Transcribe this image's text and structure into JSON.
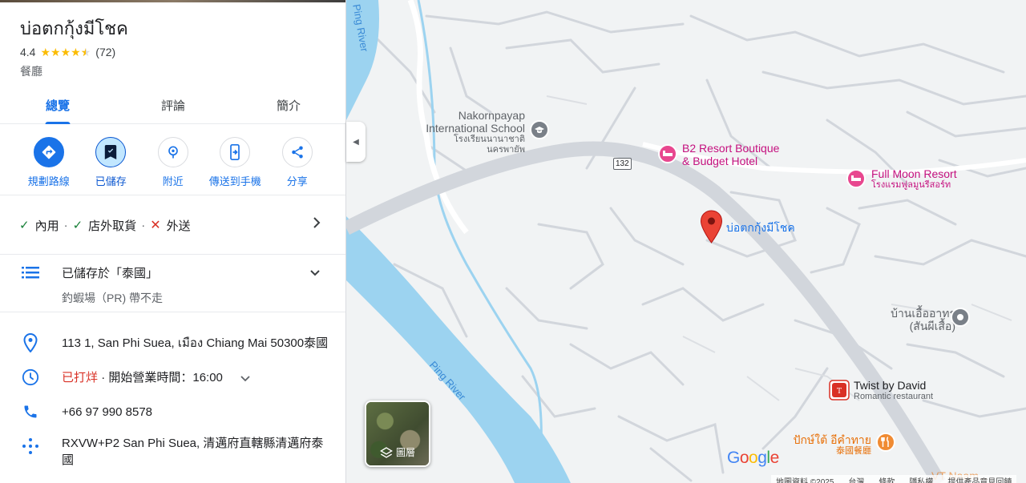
{
  "place": {
    "name": "บ่อตกกุ้งมีโชค",
    "rating": "4.4",
    "stars_value": 4.4,
    "review_count": "(72)",
    "category": "餐廳"
  },
  "tabs": [
    {
      "label": "總覽",
      "active": true
    },
    {
      "label": "評論",
      "active": false
    },
    {
      "label": "簡介",
      "active": false
    }
  ],
  "actions": [
    {
      "label": "規劃路線",
      "icon": "directions-icon"
    },
    {
      "label": "已儲存",
      "icon": "bookmark-icon"
    },
    {
      "label": "附近",
      "icon": "nearby-icon"
    },
    {
      "label": "傳送到手機",
      "icon": "send-to-phone-icon"
    },
    {
      "label": "分享",
      "icon": "share-icon"
    }
  ],
  "services": {
    "dine_in": "內用",
    "takeout": "店外取貨",
    "delivery": "外送",
    "separator": "·"
  },
  "saved_list": {
    "title": "已儲存於「泰國」",
    "subtitle": "釣蝦場（PR) 帶不走"
  },
  "info": {
    "address": "113 1, San Phi Suea, เมือง Chiang Mai 50300泰國",
    "status": "已打烊",
    "hours": "· 開始營業時間：16:00",
    "phone": "+66 97 990 8578",
    "plus_code_line1": "RXVW+P2 San Phi Suea, 清邁府直轄縣清邁府泰",
    "plus_code_line2": "國"
  },
  "map": {
    "pin_label": "บ่อตกกุ้งมีโชค",
    "labels": {
      "school_en1": "Nakornpayap",
      "school_en2": "International School",
      "school_th1": "โรงเรียนนานาชาติ",
      "school_th2": "นครพายัพ",
      "b2_1": "B2 Resort Boutique",
      "b2_2": "& Budget Hotel",
      "fullmoon_en": "Full Moon Resort",
      "fullmoon_th": "โรงแรมฟูลมูนรีสอร์ท",
      "baan_1": "บ้านเอื้ออาทร",
      "baan_2": "(สันผีเสื้อ)",
      "twist_1": "Twist by David",
      "twist_2": "Romantic restaurant",
      "pakthai_1": "ปักษ์ใต้ อีคำทาย",
      "pakthai_2": "泰國餐廳",
      "river_top": "Ping River",
      "river_mid": "Ping River",
      "road_shield": "132",
      "truncated": "VT Naam..."
    },
    "layers_label": "圖層",
    "google": "Google",
    "footer": [
      "地圖資料 ©2025",
      "台灣",
      "條款",
      "隱私權",
      "提供產品意見回饋"
    ]
  },
  "colors": {
    "accent": "#1a73e8",
    "closed": "#d93025",
    "check": "#188038",
    "pin": "#ea4335",
    "water": "#9cd3f0"
  }
}
